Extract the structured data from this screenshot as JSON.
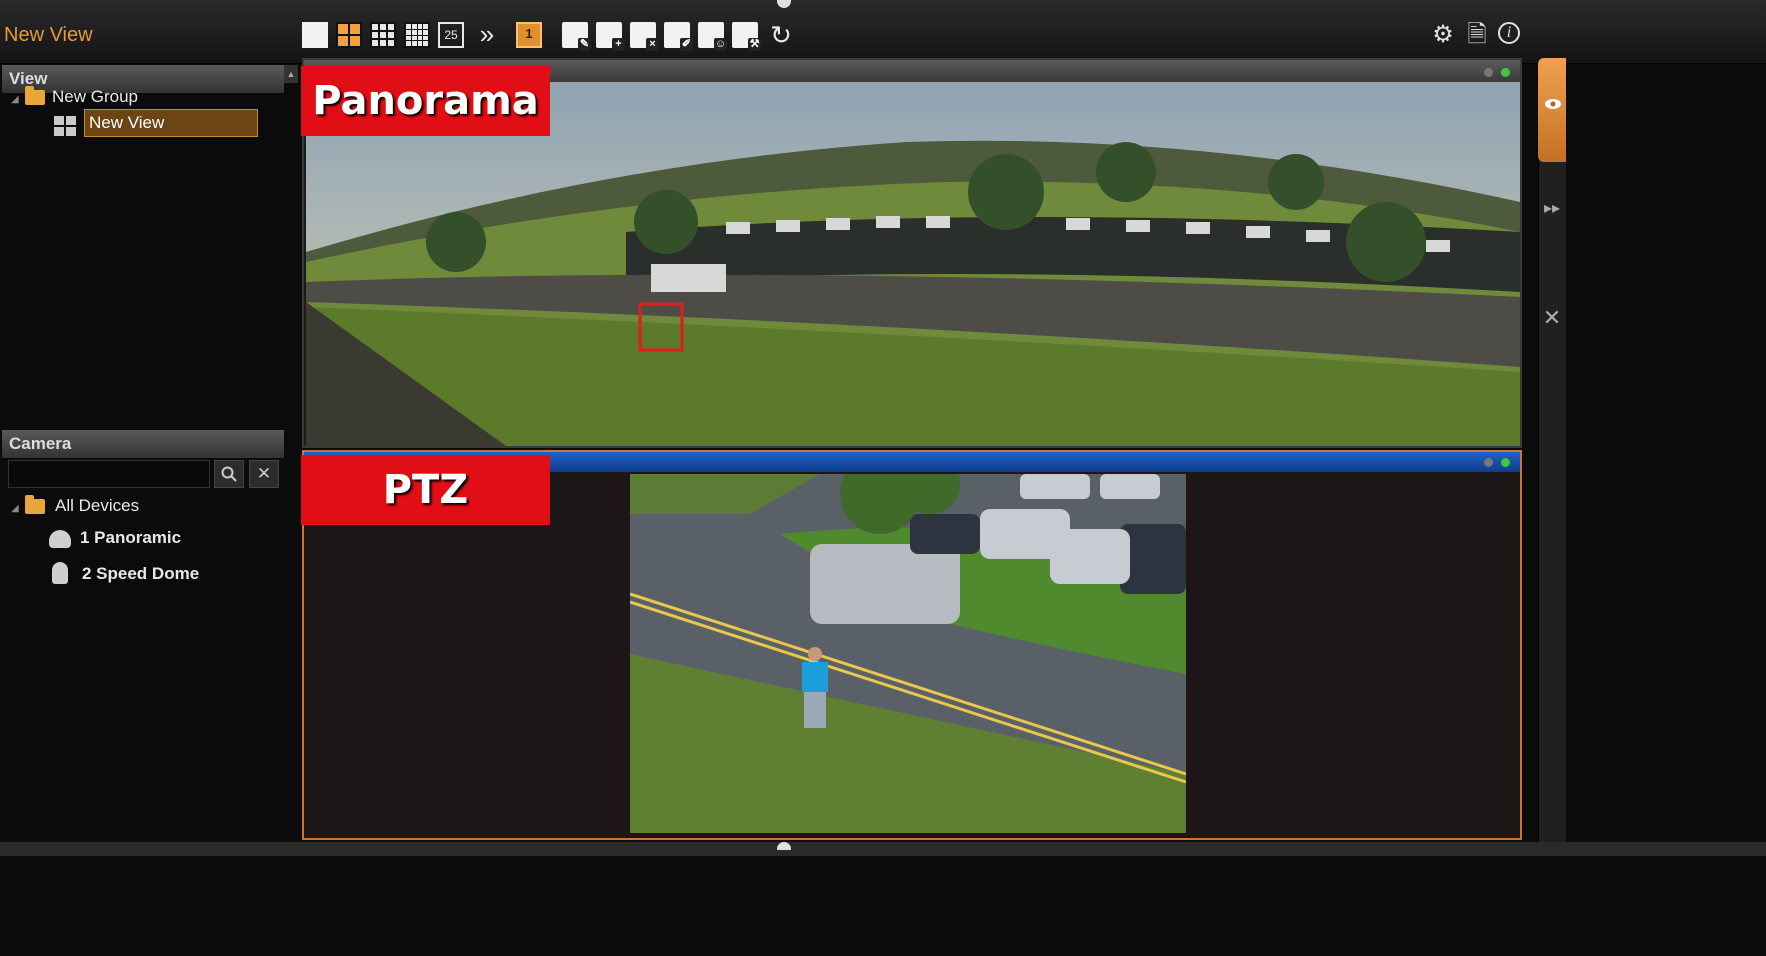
{
  "app": {
    "title": "New View"
  },
  "toolbar": {
    "layout_25_label": "25",
    "active_monitor_label": "1",
    "more_glyph": "»",
    "refresh_glyph": "↻",
    "settings_icon": "gear-icon",
    "document_icon": "document-icon",
    "info_icon": "info-icon",
    "info_glyph": "i"
  },
  "view_panel": {
    "header": "View",
    "group": "New Group",
    "view_item": "New View"
  },
  "camera_panel": {
    "header": "Camera",
    "search_value": "",
    "search_placeholder": "",
    "root": "All Devices",
    "devices": [
      {
        "label": "1 Panoramic",
        "icon": "panoramic-camera-icon"
      },
      {
        "label": "2 Speed Dome",
        "icon": "speed-dome-camera-icon"
      }
    ]
  },
  "video": {
    "panorama_label": "Panorama",
    "ptz_label": "PTZ"
  },
  "colors": {
    "accent_orange": "#e59a3c",
    "label_red": "#e10e15",
    "active_bar_blue": "#2262c4",
    "status_green": "#3ccb3c"
  }
}
